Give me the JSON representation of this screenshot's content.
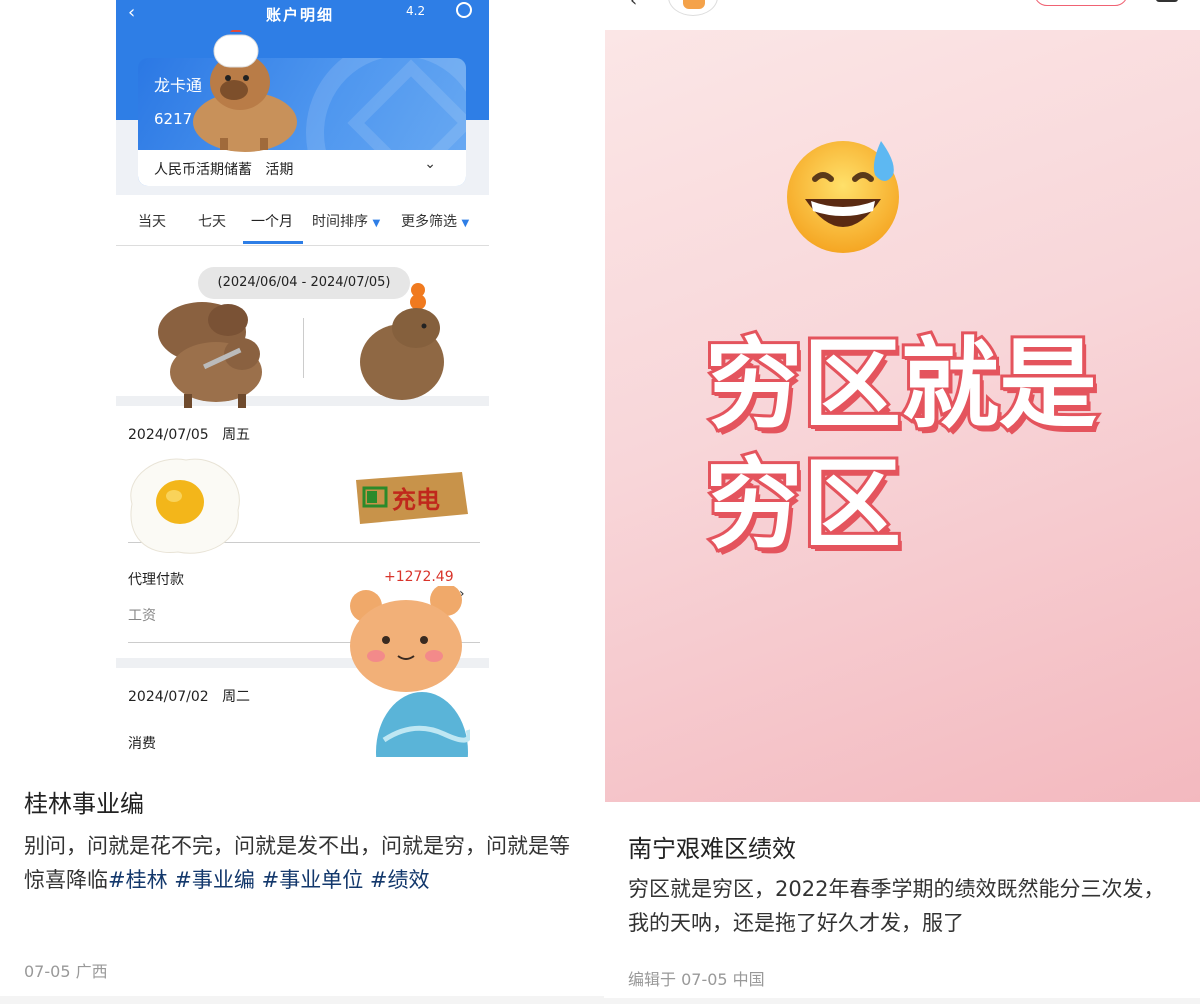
{
  "left_post": {
    "screenshot": {
      "nav_title": "账户明细",
      "nav_version": "4.2",
      "card": {
        "name": "龙卡通",
        "number": "6217",
        "account_type": "人民币活期储蓄",
        "account_mode": "活期"
      },
      "tabs": [
        "当天",
        "七天",
        "一个月",
        "时间排序",
        "更多筛选"
      ],
      "active_tab": "一个月",
      "date_range": "(2024/06/04 - 2024/07/05)",
      "groups": [
        {
          "date": "2024/07/05",
          "weekday": "周五",
          "transactions": [
            {
              "name": "代理付款",
              "amount": "+1272.49",
              "note": "工资"
            }
          ]
        },
        {
          "date": "2024/07/02",
          "weekday": "周二",
          "transactions": [
            {
              "name": "消费"
            }
          ]
        }
      ],
      "sticker_text": "充电"
    },
    "title": "桂林事业编",
    "body_text": "别问，问就是花不完，问就是发不出，问就是穷，问就是等惊喜降临",
    "tags": [
      "#桂林",
      "#事业编",
      "#事业单位",
      "#绩效"
    ],
    "meta": "07-05 广西"
  },
  "right_post": {
    "cover_line1": "穷区就是",
    "cover_line2": "穷区",
    "title": "南宁艰难区绩效",
    "body_text": "穷区就是穷区，2022年春季学期的绩效既然能分三次发，我的天呐，还是拖了好久才发，服了",
    "meta": "编辑于 07-05 中国"
  },
  "colors": {
    "bank_blue": "#2e7ee6",
    "amount_red": "#d9342b",
    "tag_blue": "#13386c",
    "cover_text_outline": "#e4545d",
    "cover_bg": "#f8d6d9"
  },
  "icons": [
    "back-arrow-icon",
    "chevron-down-icon",
    "chevron-right-icon",
    "sort-triangle-icon",
    "grinning-sweat-emoji-icon",
    "share-icon"
  ]
}
